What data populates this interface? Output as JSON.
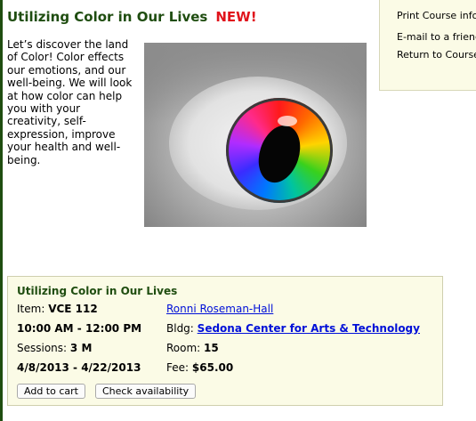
{
  "course": {
    "title": "Utilizing Color in Our Lives",
    "new_badge": "NEW!",
    "description": "Let’s discover the land of Color! Color effects our emotions, and our well-being.  We will look at how color can help you with your creativity, self-expression, improve your health and well-being."
  },
  "side_links": [
    {
      "label": "Print Course infor"
    },
    {
      "label": "E-mail to a friend"
    },
    {
      "label": "Return to Course"
    }
  ],
  "details": {
    "title": "Utilizing Color in Our Lives",
    "item_label": "Item:",
    "item_value": "VCE 112",
    "time": "10:00 AM - 12:00 PM",
    "sessions_label": "Sessions:",
    "sessions_value": "3 M",
    "dates": "4/8/2013 - 4/22/2013",
    "instructor": "Ronni Roseman-Hall",
    "bldg_label": "Bldg:",
    "bldg_value": "Sedona Center for Arts & Technology",
    "room_label": "Room:",
    "room_value": "15",
    "fee_label": "Fee:",
    "fee_value": "$65.00"
  },
  "buttons": {
    "add_to_cart": "Add to cart",
    "check_availability": "Check availability"
  },
  "colors": {
    "title_green": "#1f4d10",
    "new_red": "#e0131b",
    "link_blue": "#0010d8",
    "panel_bg": "#fbfbe6"
  }
}
